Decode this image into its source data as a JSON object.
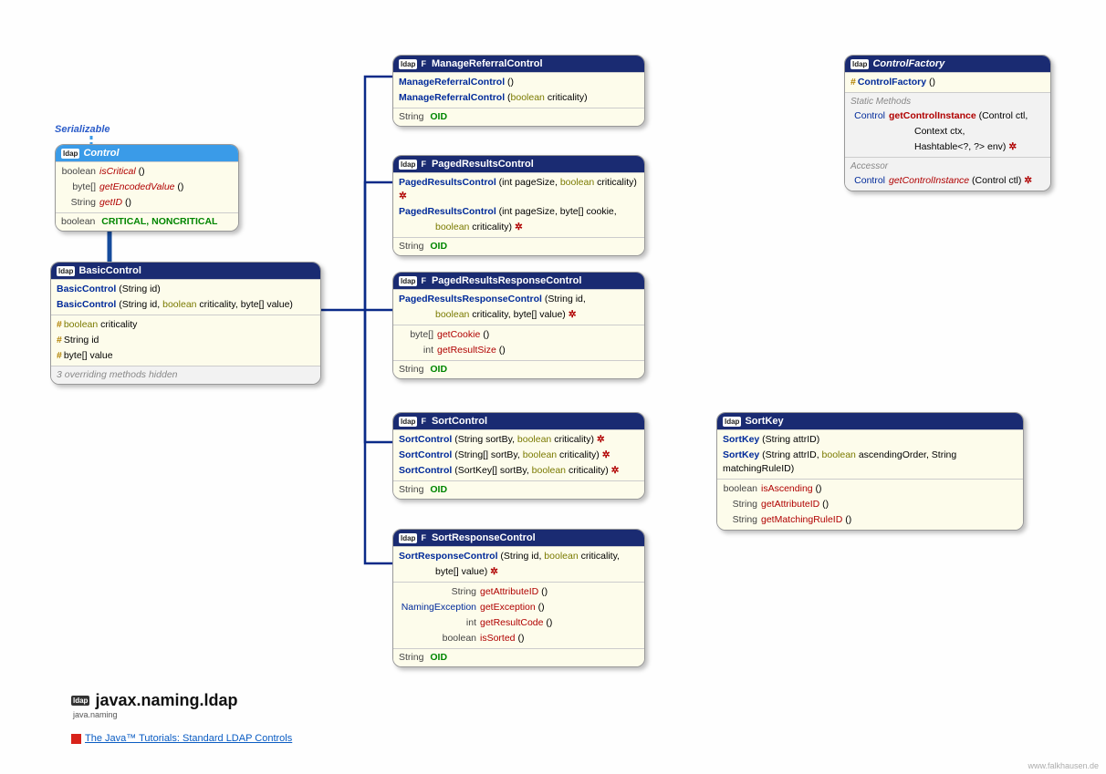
{
  "serializable": "Serializable",
  "icon_text": "ldap",
  "control": {
    "title": "Control",
    "m1_ret": "boolean",
    "m1": "isCritical",
    "m2_ret": "byte[]",
    "m2": "getEncodedValue",
    "m3_ret": "String",
    "m3": "getID",
    "const_ret": "boolean",
    "const1": "CRITICAL",
    "const_sep": ", ",
    "const2": "NONCRITICAL"
  },
  "basic": {
    "title": "BasicControl",
    "c1": "BasicControl",
    "c1_p": " (String id)",
    "c2": "BasicControl",
    "c2_p1": " (String id, ",
    "c2_kw": "boolean",
    "c2_p2": " criticality, byte[] value)",
    "f1_kw": "boolean",
    "f1": " criticality",
    "f2": "String id",
    "f3": "byte[]  value",
    "note": "3 overriding methods hidden"
  },
  "mrc": {
    "title": "ManageReferralControl",
    "c1": "ManageReferralControl",
    "c1_p": " ()",
    "c2": "ManageReferralControl",
    "c2_p1": " (",
    "c2_kw": "boolean",
    "c2_p2": " criticality)",
    "oid_ret": "String",
    "oid": "OID"
  },
  "prc": {
    "title": "PagedResultsControl",
    "c1": "PagedResultsControl",
    "c1_p1": " (int pageSize, ",
    "c1_kw": "boolean",
    "c1_p2": " criticality) ",
    "c2": "PagedResultsControl",
    "c2_p1": " (int pageSize, byte[] cookie,",
    "c2_line2_kw": "boolean",
    "c2_line2_txt": " criticality) ",
    "oid_ret": "String",
    "oid": "OID"
  },
  "prrc": {
    "title": "PagedResultsResponseControl",
    "c1": "PagedResultsResponseControl",
    "c1_p1": " (String id,",
    "c1_line2_kw": "boolean",
    "c1_line2_txt": " criticality, byte[] value) ",
    "m1_ret": "byte[]",
    "m1": "getCookie",
    "m2_ret": "int",
    "m2": "getResultSize",
    "oid_ret": "String",
    "oid": "OID"
  },
  "sc": {
    "title": "SortControl",
    "c1": "SortControl",
    "c1_p1": " (String sortBy, ",
    "c1_kw": "boolean",
    "c1_p2": " criticality) ",
    "c2": "SortControl",
    "c2_p1": " (String[] sortBy, ",
    "c2_kw": "boolean",
    "c2_p2": " criticality) ",
    "c3": "SortControl",
    "c3_p1": " (SortKey[] sortBy, ",
    "c3_kw": "boolean",
    "c3_p2": " criticality) ",
    "oid_ret": "String",
    "oid": "OID"
  },
  "src": {
    "title": "SortResponseControl",
    "c1": "SortResponseControl",
    "c1_p1": " (String id, ",
    "c1_kw": "boolean",
    "c1_p2": " criticality,",
    "c1_line2": "byte[] value) ",
    "m1_ret": "String",
    "m1": "getAttributeID",
    "m2_ret": "NamingException",
    "m2": "getException",
    "m3_ret": "int",
    "m3": "getResultCode",
    "m4_ret": "boolean",
    "m4": "isSorted",
    "oid_ret": "String",
    "oid": "OID"
  },
  "sortkey": {
    "title": "SortKey",
    "c1": "SortKey",
    "c1_p": " (String attrID)",
    "c2": "SortKey",
    "c2_p1": " (String attrID, ",
    "c2_kw": "boolean",
    "c2_p2": " ascendingOrder, String matchingRuleID)",
    "m1_ret": "boolean",
    "m1": "isAscending",
    "m2_ret": "String",
    "m2": "getAttributeID",
    "m3_ret": "String",
    "m3": "getMatchingRuleID"
  },
  "cf": {
    "title": "ControlFactory",
    "c1": "ControlFactory",
    "sm_label": "Static Methods",
    "sm_ret": "Control",
    "sm": "getControlInstance",
    "sm_p1": " (Control ctl,",
    "sm_l2": "Context ctx,",
    "sm_l3": "Hashtable<?, ?> env) ",
    "acc_label": "Accessor",
    "am_ret": "Control",
    "am": "getControlInstance",
    "am_p": " (Control ctl) "
  },
  "pkg": "javax.naming.ldap",
  "pkg_sub": "java.naming",
  "tutorial": "The Java™ Tutorials: Standard LDAP Controls",
  "credit": "www.falkhausen.de",
  "f_marker": "F",
  "paren": " ()"
}
